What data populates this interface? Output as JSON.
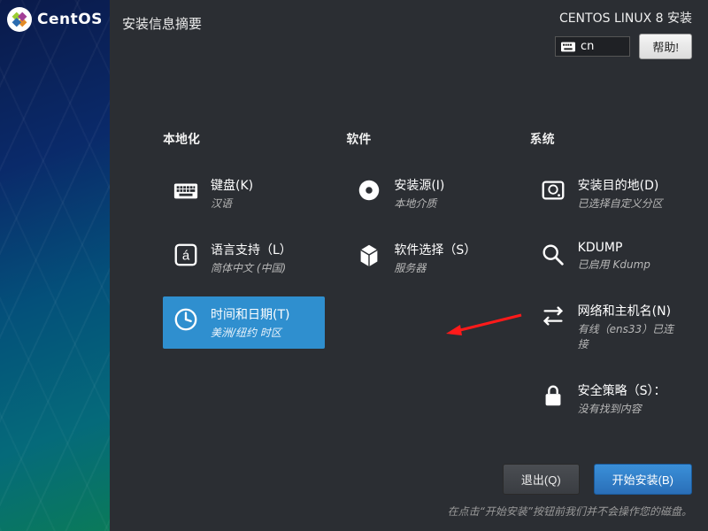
{
  "brand": {
    "name": "CentOS"
  },
  "header": {
    "page_title": "安装信息摘要",
    "product": "CENTOS LINUX 8 安装",
    "lang_indicator": "cn",
    "help_label": "帮助!"
  },
  "categories": {
    "localization": {
      "title": "本地化",
      "keyboard": {
        "title": "键盘(K)",
        "sub": "汉语"
      },
      "language": {
        "title": "语言支持（L）",
        "sub": "简体中文 (中国)"
      },
      "datetime": {
        "title": "时间和日期(T)",
        "sub": "美洲/纽约 时区"
      }
    },
    "software": {
      "title": "软件",
      "source": {
        "title": "安装源(I)",
        "sub": "本地介质"
      },
      "selection": {
        "title": "软件选择（S）",
        "sub": "服务器"
      }
    },
    "system": {
      "title": "系统",
      "destination": {
        "title": "安装目的地(D)",
        "sub": "已选择自定义分区"
      },
      "kdump": {
        "title": "KDUMP",
        "sub": "已启用 Kdump"
      },
      "network": {
        "title": "网络和主机名(N)",
        "sub": "有线（ens33）已连接"
      },
      "security": {
        "title": "安全策略（S）：",
        "sub": "没有找到内容"
      }
    }
  },
  "footer": {
    "quit_label": "退出(Q)",
    "begin_label": "开始安装(B)",
    "hint": "在点击“开始安装”按钮前我们并不会操作您的磁盘。"
  }
}
